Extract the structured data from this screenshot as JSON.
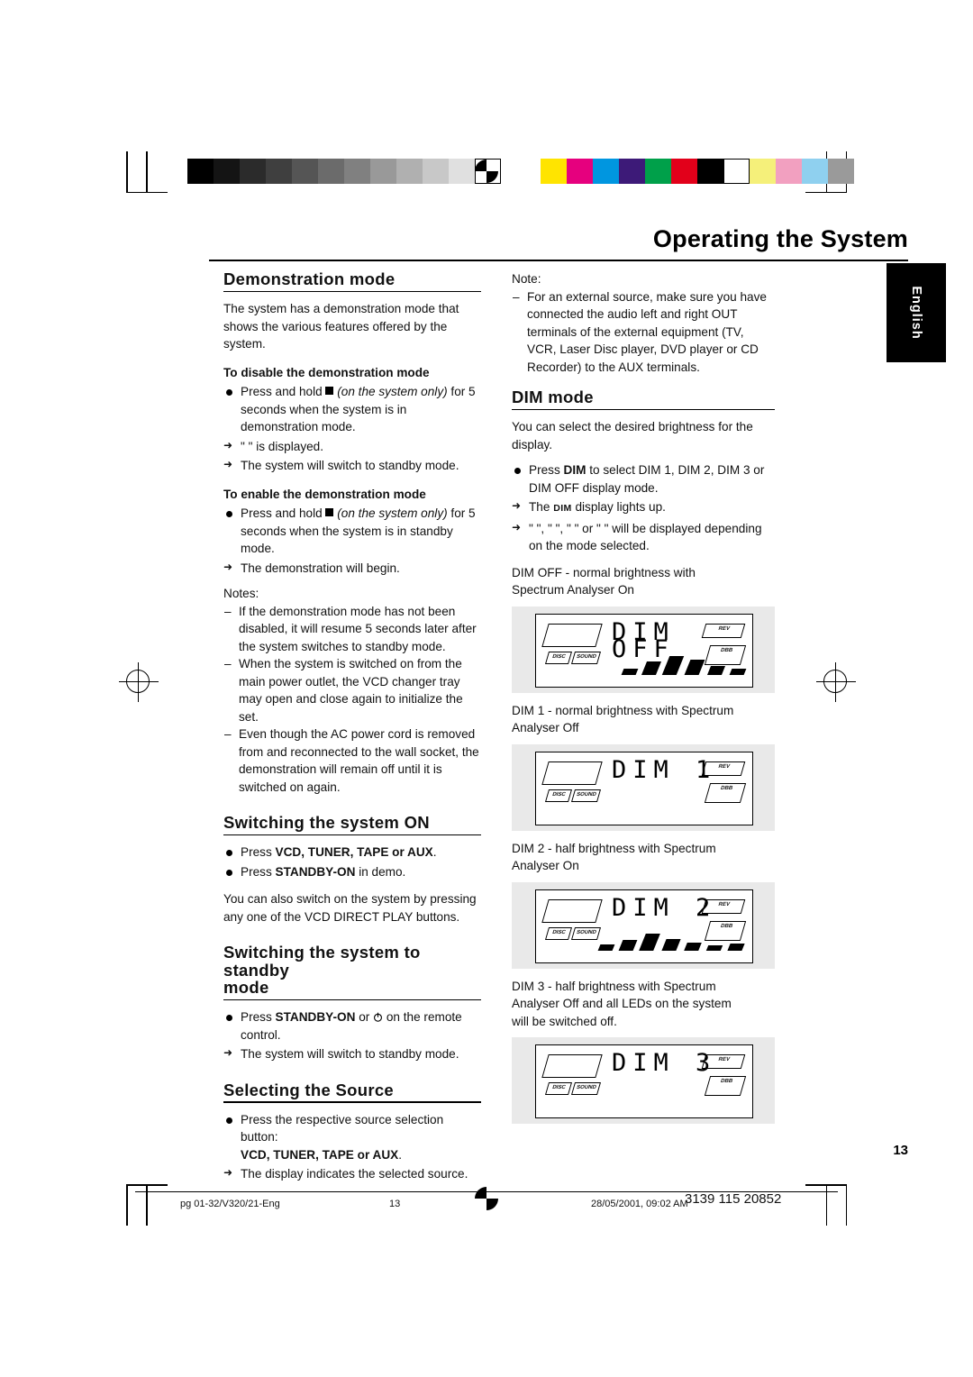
{
  "header": {
    "title": "Operating the System",
    "english_tab": "English",
    "page_number": "13"
  },
  "left_column": {
    "demo": {
      "heading": "Demonstration mode",
      "intro": "The system has a demonstration mode that shows the various features offered by the system.",
      "disable_heading": "To disable the demonstration mode",
      "disable_bullet_pre": "Press and hold",
      "disable_bullet_ital": "(on the system only)",
      "disable_bullet_post": "for 5 seconds  when the system is in demonstration mode.",
      "disable_arrow1": "\"                       \" is displayed.",
      "disable_arrow2": "The system will switch to standby mode.",
      "enable_heading": "To enable the demonstration mode",
      "enable_bullet_pre": "Press and hold",
      "enable_bullet_ital": "(on the system only)",
      "enable_bullet_post": "for 5 seconds  when the system is in standby mode.",
      "enable_arrow1": "The demonstration will begin.",
      "notes_label": "Notes:",
      "note1": "If the demonstration mode has not been disabled, it will resume 5 seconds later after the system switches to standby mode.",
      "note2": "When the system is switched on from the main power outlet, the VCD changer tray may open and close again to initialize the set.",
      "note3": "Even though the AC power cord is removed from and reconnected to the wall socket, the demonstration will remain off until it is switched on again."
    },
    "switch_on": {
      "heading": "Switching the system ON",
      "bullet1_pre": "Press",
      "bullet1_bold": "VCD, TUNER, TAPE or AUX",
      "bullet1_post": ".",
      "bullet2_pre": "Press",
      "bullet2_bold": "STANDBY-ON",
      "bullet2_post": "in demo.",
      "para": "You can also switch on the system by pressing any one of the VCD DIRECT PLAY buttons."
    },
    "switch_standby": {
      "heading_line1": "Switching the system to standby",
      "heading_line2": "mode",
      "bullet_pre": "Press",
      "bullet_bold": "STANDBY-ON",
      "bullet_mid": "or",
      "bullet_post": "on the remote control.",
      "arrow": "The system will switch to standby mode."
    },
    "select_source": {
      "heading": "Selecting the Source",
      "bullet": "Press the respective source selection button:",
      "bullet_bold": "VCD, TUNER, TAPE or AUX",
      "bullet_bold_tail": ".",
      "arrow": "The display indicates the selected source."
    }
  },
  "right_column": {
    "note_label": "Note:",
    "note_text": "For an external source, make sure you have connected the audio left and right OUT terminals of the external equipment (TV, VCR, Laser Disc player, DVD player or CD Recorder) to the AUX terminals.",
    "dim": {
      "heading": "DIM mode",
      "intro": "You can select the desired brightness for the display.",
      "bullet_pre": "Press",
      "bullet_bold": "DIM",
      "bullet_post": "to select DIM 1, DIM 2, DIM 3 or DIM OFF display mode.",
      "arrow1_pre": "The",
      "arrow1_dim": "DIM",
      "arrow1_post": "display lights up.",
      "arrow2": "\"            \", \"               \", \"           \" or \"                    \" will be displayed depending on the mode selected.",
      "caption_off_line1": "DIM OFF - normal brightness with",
      "caption_off_line2": "Spectrum Analyser On",
      "caption_1_line1": "DIM 1 - normal brightness with Spectrum",
      "caption_1_line2": "Analyser Off",
      "caption_2_line1": "DIM 2 - half brightness with Spectrum",
      "caption_2_line2": "Analyser On",
      "caption_3_line1": "DIM 3 - half brightness with Spectrum",
      "caption_3_line2": "Analyser Off and all LEDs on the system",
      "caption_3_line3": "will be switched off.",
      "display_off": "DIM OFF",
      "display_1": "DIM 1",
      "display_2": "DIM 2",
      "display_3": "DIM 3",
      "lcd_badge_top": "REV",
      "lcd_badge_bottom": "DBB",
      "lcd_badge_left_top": "DISC",
      "lcd_badge_left_bottom": "SOUND"
    }
  },
  "footer": {
    "left": "pg 01-32/V320/21-Eng",
    "center": "13",
    "right": "28/05/2001, 09:02 AM",
    "code": "3139 115 20852"
  },
  "colors": {
    "bar_colors": [
      "#ffe400",
      "#e6007e",
      "#0096e0",
      "#3d1a78",
      "#00a04a",
      "#e2001a",
      "#000000",
      "#ffffff",
      "#f5f07a",
      "#f2a0c0",
      "#8fd0ef",
      "#9a9a9a"
    ],
    "gray_steps": [
      "#000000",
      "#141414",
      "#2b2b2b",
      "#3f3f3f",
      "#555555",
      "#6b6b6b",
      "#808080",
      "#999999",
      "#b0b0b0",
      "#c8c8c8",
      "#e0e0e0",
      "#ffffff"
    ]
  }
}
